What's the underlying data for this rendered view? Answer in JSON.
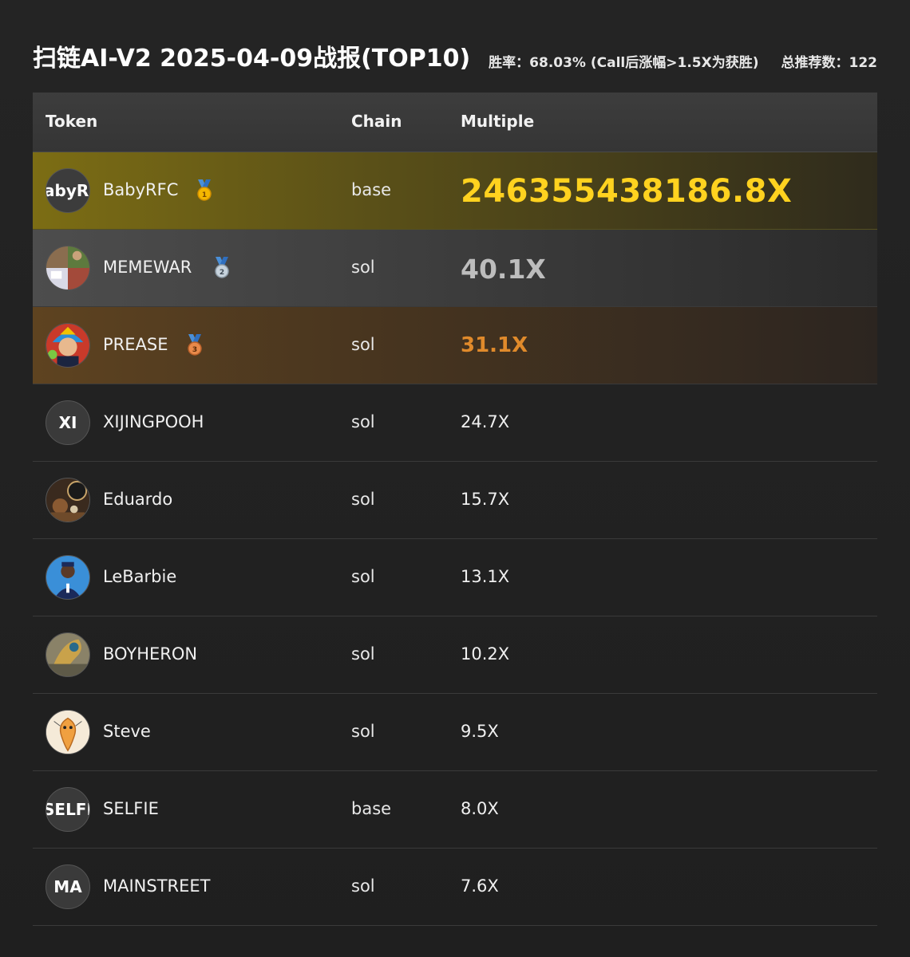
{
  "header": {
    "title": "扫链AI-V2 2025-04-09战报(TOP10)",
    "win_rate": "胜率：68.03% (Call后涨幅>1.5X为获胜)",
    "total": "总推荐数：122"
  },
  "table": {
    "columns": [
      "Token",
      "Chain",
      "Multiple"
    ],
    "rows": [
      {
        "token": "BabyRFC",
        "avatar_text": "abyRI",
        "chain": "base",
        "multiple": "246355438186.8X",
        "medal": "gold-medal-icon",
        "medal_number": "1"
      },
      {
        "token": "MEMEWAR",
        "avatar_text": "",
        "chain": "sol",
        "multiple": "40.1X",
        "medal": "silver-medal-icon",
        "medal_number": "2"
      },
      {
        "token": "PREASE",
        "avatar_text": "",
        "chain": "sol",
        "multiple": "31.1X",
        "medal": "bronze-medal-icon",
        "medal_number": "3"
      },
      {
        "token": "XIJINGPOOH",
        "avatar_text": "XI",
        "chain": "sol",
        "multiple": "24.7X"
      },
      {
        "token": "Eduardo",
        "avatar_text": "",
        "chain": "sol",
        "multiple": "15.7X"
      },
      {
        "token": "LeBarbie",
        "avatar_text": "",
        "chain": "sol",
        "multiple": "13.1X"
      },
      {
        "token": "BOYHERON",
        "avatar_text": "",
        "chain": "sol",
        "multiple": "10.2X"
      },
      {
        "token": "Steve",
        "avatar_text": "",
        "chain": "sol",
        "multiple": "9.5X"
      },
      {
        "token": "SELFIE",
        "avatar_text": "SELFII",
        "chain": "base",
        "multiple": "8.0X"
      },
      {
        "token": "MAINSTREET",
        "avatar_text": "MA",
        "chain": "sol",
        "multiple": "7.6X"
      }
    ]
  },
  "colors": {
    "gold": "#ffd21f",
    "silver": "#bdbdbd",
    "bronze": "#e08a2b",
    "background": "#222222"
  }
}
